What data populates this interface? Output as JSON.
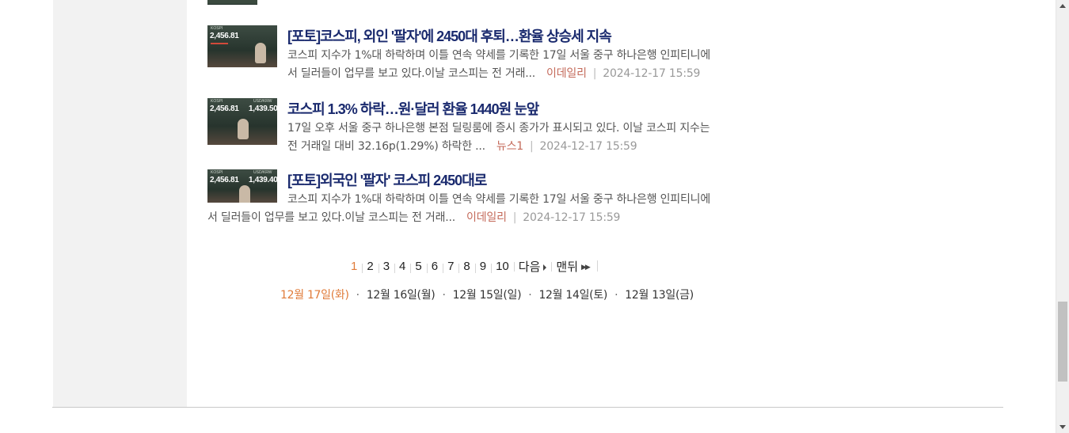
{
  "articles": [
    {
      "title": "[포토]코스피, 외인 '팔자'에 2450대 후퇴…환율 상승세 지속",
      "summary_line1": "코스피 지수가 1%대 하락하며 이틀 연속 약세를 기록한 17일 서울 중구 하나은행 인피티니에",
      "summary_line2": "서 딜러들이 업무를 보고 있다.이날 코스피는 전 거래...",
      "source": "이데일리",
      "date": "2024-12-17 15:59",
      "thumb_value": "2,456.81"
    },
    {
      "title": "코스피 1.3% 하락…원·달러 환율 1440원 눈앞",
      "summary_line1": "17일 오후 서울 중구 하나은행 본점 딜링룸에 증시 종가가 표시되고 있다. 이날 코스피 지수는",
      "summary_line2": "전 거래일 대비 32.16p(1.29%) 하락한 ...",
      "source": "뉴스1",
      "date": "2024-12-17 15:59",
      "thumb_value": "2,456.81",
      "thumb_value2": "1,439.50"
    },
    {
      "title": "[포토]외국인 '팔자' 코스피 2450대로",
      "summary_line1": "코스피 지수가 1%대 하락하며 이틀 연속 약세를 기록한 17일 서울 중구 하나은행 인피티니에",
      "summary_line2": "서 딜러들이 업무를 보고 있다.이날 코스피는 전 거래...",
      "source": "이데일리",
      "date": "2024-12-17 15:59",
      "thumb_value": "2,456.81",
      "thumb_value2": "1,439.40"
    }
  ],
  "pagination": {
    "pages": [
      "1",
      "2",
      "3",
      "4",
      "5",
      "6",
      "7",
      "8",
      "9",
      "10"
    ],
    "current": "1",
    "next_label": "다음",
    "last_label": "맨뒤"
  },
  "days": {
    "current": "12월 17일(화)",
    "others": [
      "12월 16일(월)",
      "12월 15일(일)",
      "12월 14일(토)",
      "12월 13일(금)"
    ]
  },
  "colors": {
    "title": "#1a2a6e",
    "accent": "#e07b39",
    "source": "#c46a5a"
  },
  "icons": {
    "next": "triangle-right-icon",
    "last": "double-triangle-right-icon",
    "scroll_up": "scroll-up-arrow-icon",
    "scroll_down": "scroll-down-arrow-icon"
  }
}
